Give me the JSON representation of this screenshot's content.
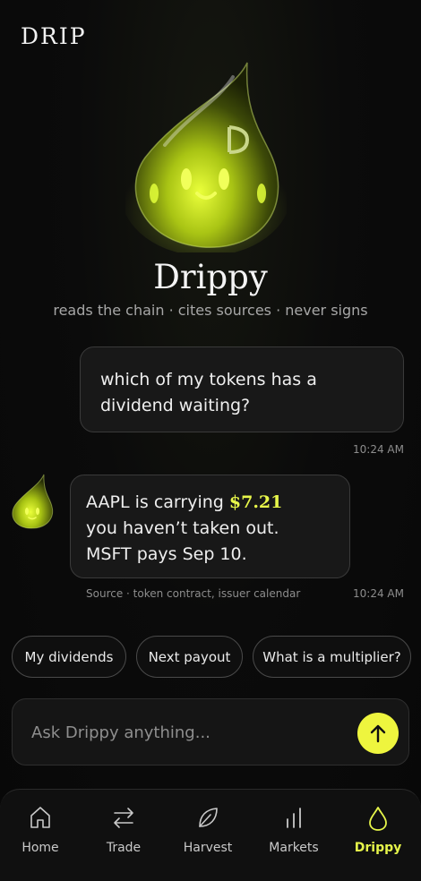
{
  "app": {
    "brand": "DRIP"
  },
  "assistant": {
    "name": "Drippy",
    "tagline": "reads the chain · cites sources · never signs"
  },
  "messages": {
    "user": {
      "text_line1": "which of my tokens has a",
      "text_line2": "dividend waiting?",
      "time": "10:24 AM"
    },
    "bot": {
      "line1_prefix": "AAPL is carrying ",
      "line1_amount": "$7.21",
      "line2": "you haven’t taken out.",
      "line3": "MSFT pays Sep 10.",
      "source": "Source · token contract, issuer calendar",
      "time": "10:24 AM"
    }
  },
  "suggestions": [
    "My dividends",
    "Next payout",
    "What is a multiplier?"
  ],
  "composer": {
    "placeholder": "Ask Drippy anything..."
  },
  "tabs": [
    {
      "label": "Home",
      "icon": "home-icon"
    },
    {
      "label": "Trade",
      "icon": "arrows-swap-icon"
    },
    {
      "label": "Harvest",
      "icon": "leaf-icon"
    },
    {
      "label": "Markets",
      "icon": "bar-chart-icon"
    },
    {
      "label": "Drippy",
      "icon": "droplet-icon",
      "active": true
    }
  ],
  "colors": {
    "accent": "#e8f74a",
    "background": "#0b0b0b"
  }
}
